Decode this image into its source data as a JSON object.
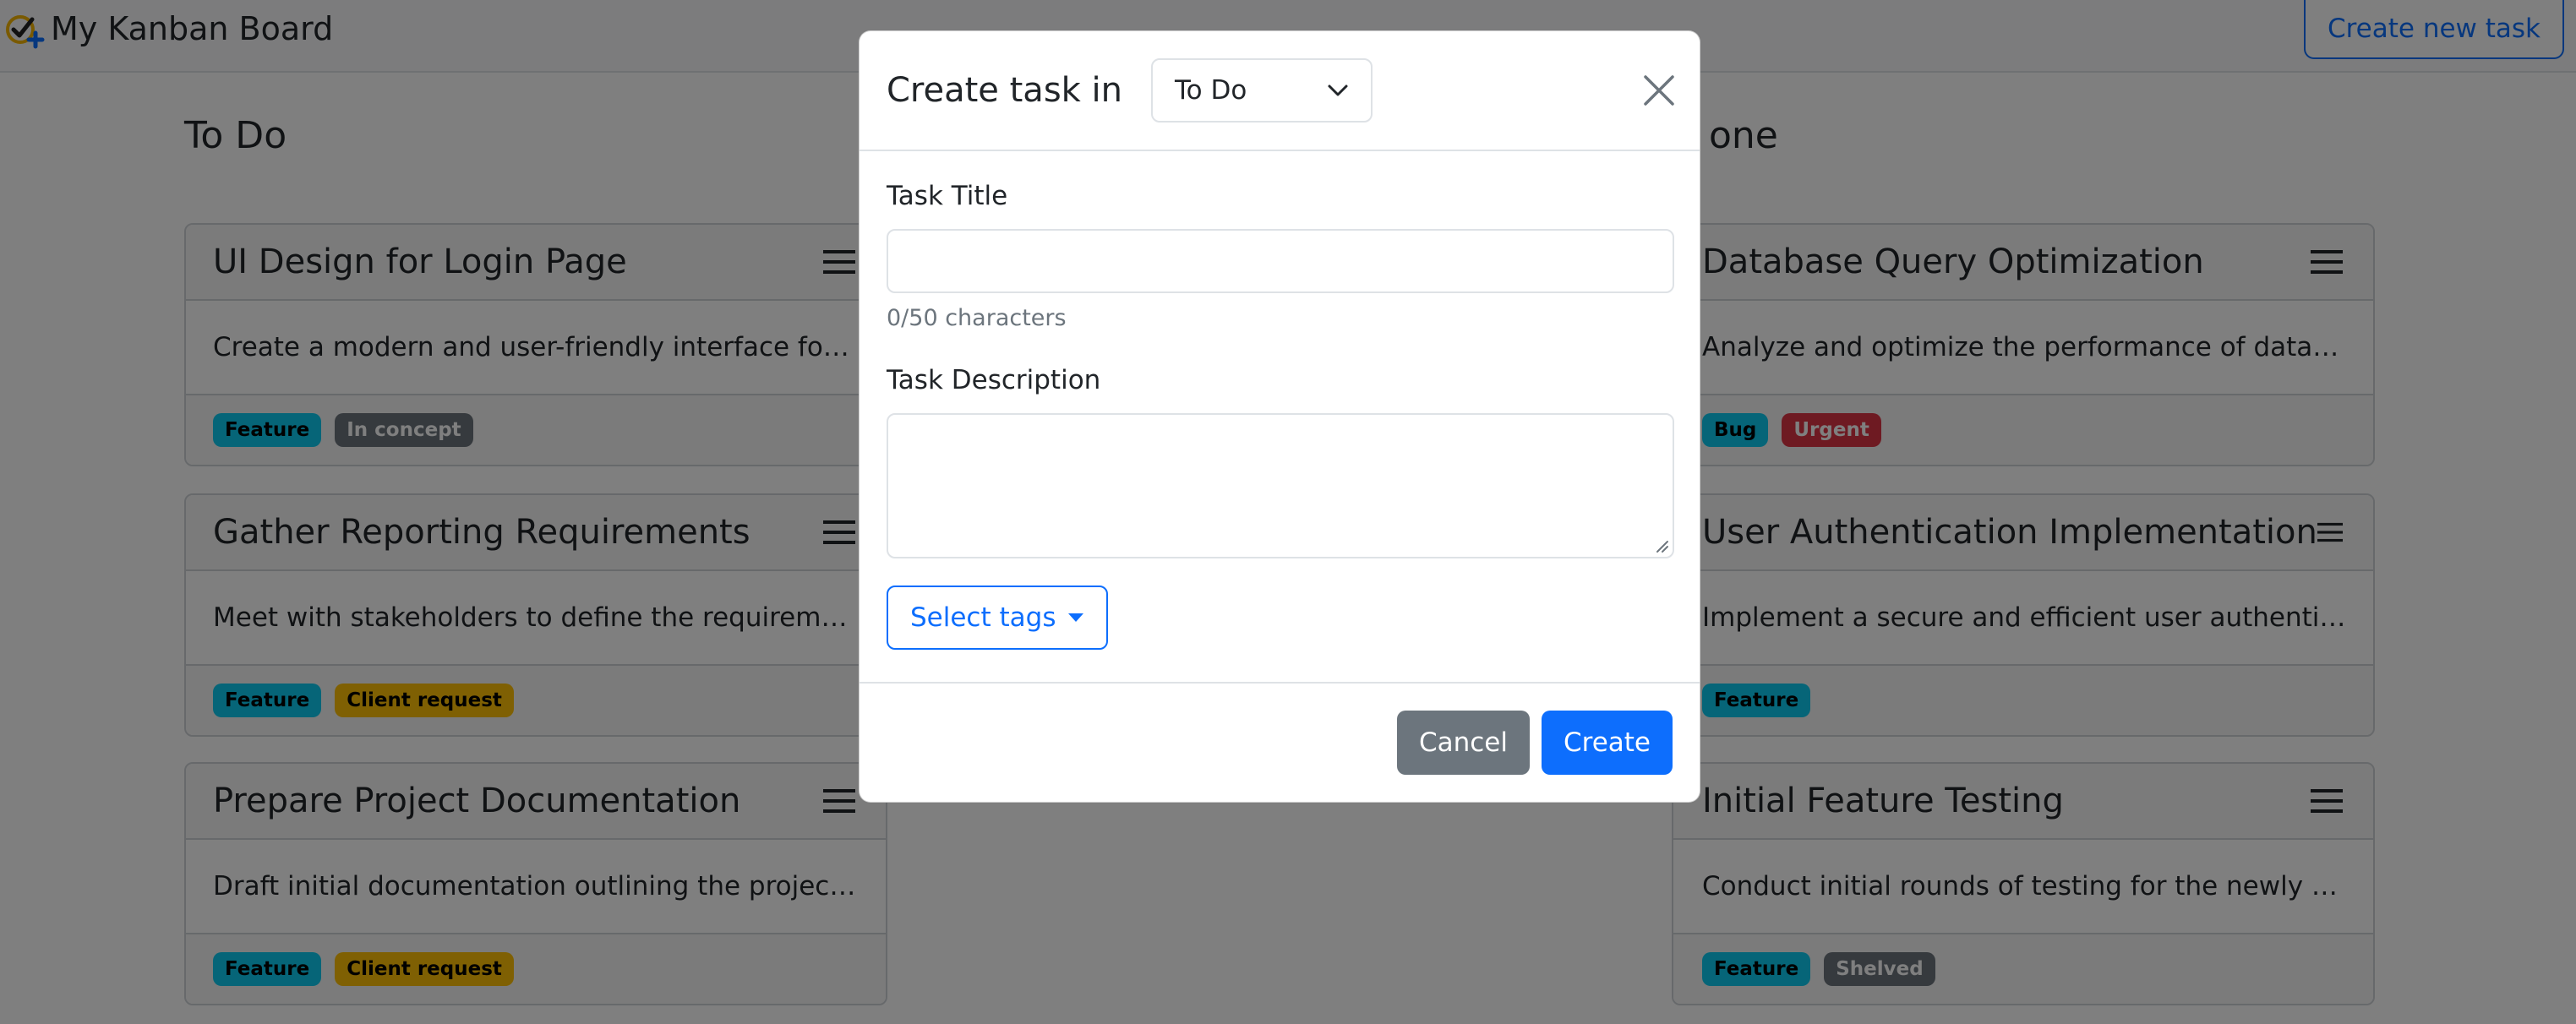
{
  "app": {
    "title": "My Kanban Board",
    "create_new_label": "Create new task"
  },
  "columns": [
    {
      "title": "To Do",
      "cards": [
        {
          "title": "UI Design for Login Page",
          "description": "Create a modern and user-friendly interface for th…",
          "tags": [
            "Feature",
            "In concept"
          ]
        },
        {
          "title": "Gather Reporting Requirements",
          "description": "Meet with stakeholders to define the requirement…",
          "tags": [
            "Feature",
            "Client request"
          ]
        },
        {
          "title": "Prepare Project Documentation",
          "description": "Draft initial documentation outlining the project s…",
          "tags": [
            "Feature",
            "Client request"
          ]
        }
      ]
    },
    {
      "title": "one",
      "cards": [
        {
          "title": "Database Query Optimization",
          "description": "Analyze and optimize the performance of databas…",
          "tags": [
            "Bug",
            "Urgent"
          ]
        },
        {
          "title": "User Authentication Implementation",
          "description": "Implement a secure and efficient user authenticati…",
          "tags": [
            "Feature"
          ]
        },
        {
          "title": "Initial Feature Testing",
          "description": "Conduct initial rounds of testing for the newly dev…",
          "tags": [
            "Feature",
            "Shelved"
          ]
        }
      ]
    }
  ],
  "modal": {
    "title": "Create task in",
    "column_select": "To Do",
    "task_title_label": "Task Title",
    "task_title_value": "",
    "char_count": "0/50 characters",
    "task_description_label": "Task Description",
    "task_description_value": "",
    "select_tags_label": "Select tags",
    "cancel_label": "Cancel",
    "create_label": "Create"
  },
  "colors": {
    "primary": "#0d6efd",
    "secondary": "#6c757d",
    "info": "#0dcaf0",
    "warning": "#ffc107",
    "danger": "#dc3545"
  },
  "icons": {
    "brand": "kanban-check-plus-icon",
    "card_menu": "hamburger-menu-icon",
    "close": "close-icon",
    "dropdown": "chevron-down-icon",
    "tags_caret": "caret-down-icon"
  }
}
